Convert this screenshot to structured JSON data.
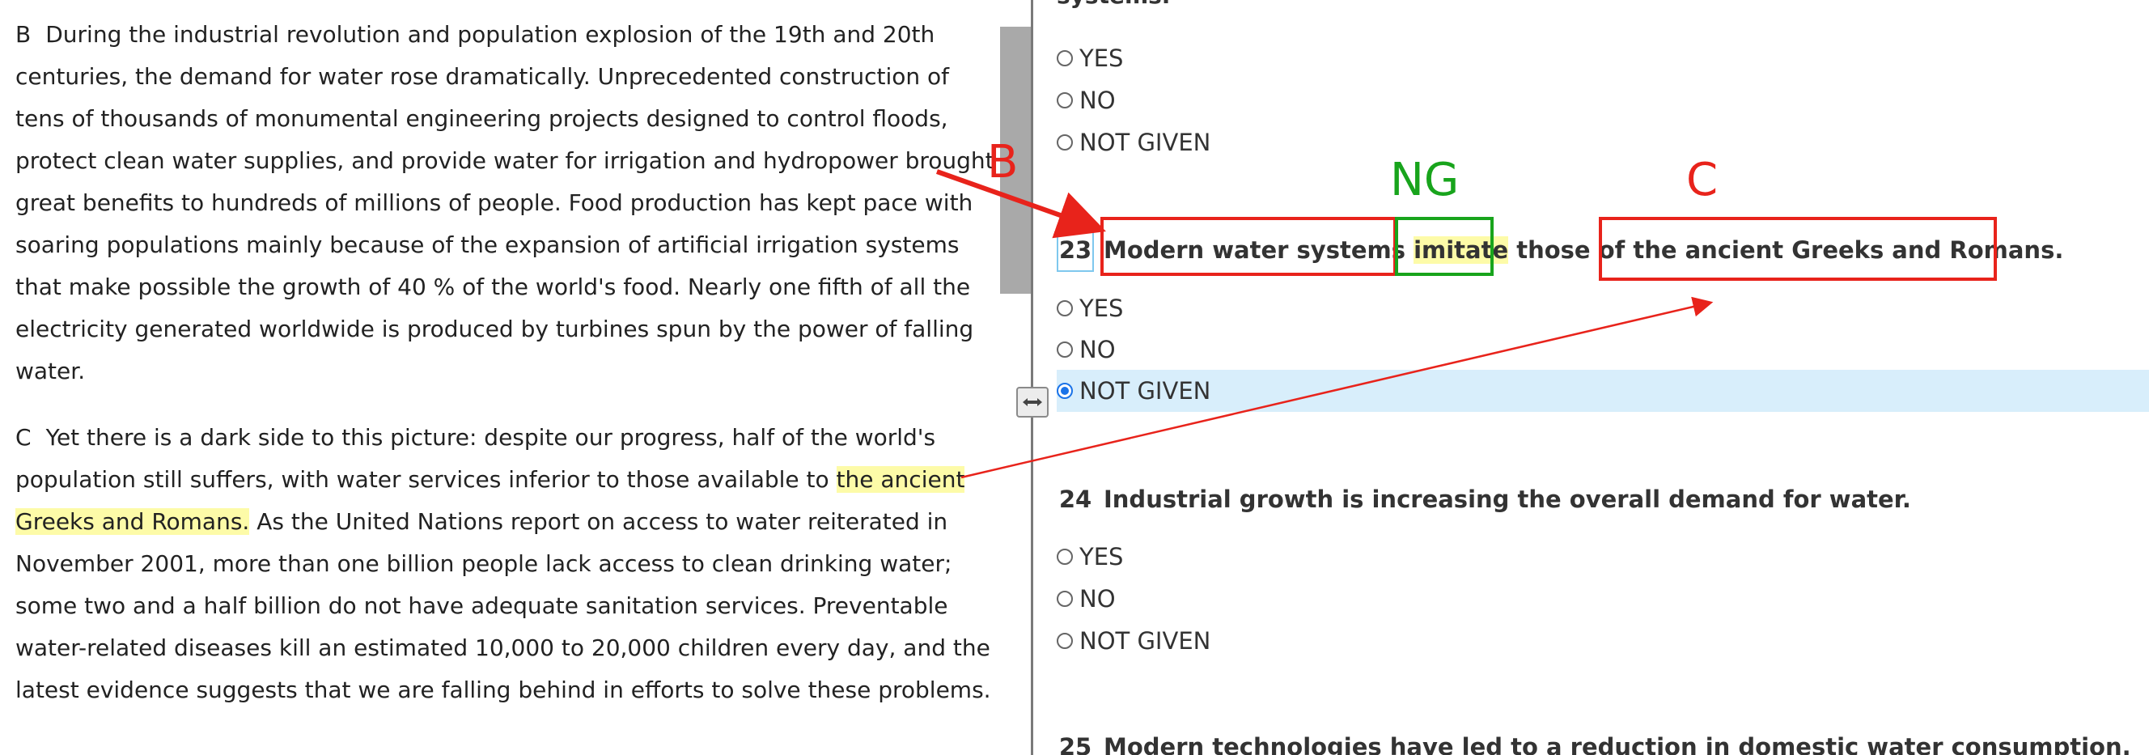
{
  "passage": {
    "para_b": {
      "letter": "B",
      "text": "During the industrial revolution and population explosion of the 19th and 20th centuries, the demand for water rose dramatically. Unprecedented construction of tens of thousands of monumental engineering projects designed to control floods, protect clean water supplies, and provide water for irrigation and hydropower brought great benefits to hundreds of millions of people. Food production has kept pace with soaring populations mainly because of the expansion of artificial irrigation systems that make possible the growth of 40 % of the world's food. Nearly one fifth of all the electricity generated worldwide is produced by turbines spun by the power of falling water."
    },
    "para_c": {
      "letter": "C",
      "text_before": "Yet there is a dark side to this picture: despite our progress, half of the world's population still suffers, with water services inferior to those available to ",
      "highlight": "the ancient Greeks and Romans.",
      "text_after": " As the United Nations report on access to water reiterated in November 2001, more than one billion people lack access to clean drinking water; some two and a half billion do not have adequate sanitation services. Preventable water-related diseases kill an estimated 10,000 to 20,000 children every day, and the latest evidence suggests that we are falling behind in efforts to solve these problems."
    }
  },
  "questions": {
    "prev_tail": "systems.",
    "options_labels": [
      "YES",
      "NO",
      "NOT GIVEN"
    ],
    "q23": {
      "number": "23",
      "part1": "Modern water systems ",
      "highlight": "imitate",
      "part2": " those of the ancient Greeks and Romans.",
      "selected": "NOT GIVEN"
    },
    "q24": {
      "number": "24",
      "text": "Industrial growth is increasing the overall demand for water."
    },
    "q25": {
      "number": "25",
      "text": "Modern technologies have led to a reduction in domestic water consumption."
    }
  },
  "annotations": {
    "label_b": "B",
    "label_ng": "NG",
    "label_c": "C",
    "colors": {
      "red": "#e8231b",
      "green": "#18a41c",
      "highlight": "#fdfba8",
      "selected_row": "#d8eefb"
    }
  }
}
